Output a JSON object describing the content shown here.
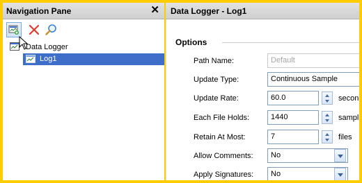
{
  "nav": {
    "title": "Navigation Pane",
    "close_glyph": "✕",
    "toolbar": {
      "add_icon": "add-logger-icon",
      "delete_icon": "delete-x-icon",
      "find_icon": "magnifier-icon"
    },
    "tree": {
      "root_label": "Data Logger",
      "child_label": "Log1"
    }
  },
  "content": {
    "title": "Data Logger - Log1",
    "section_title": "Options",
    "fields": {
      "path_name": {
        "label": "Path Name:",
        "value": "Default"
      },
      "update_type": {
        "label": "Update Type:",
        "value": "Continuous Sample"
      },
      "update_rate": {
        "label": "Update Rate:",
        "value": "60.0",
        "unit": "seconc"
      },
      "file_holds": {
        "label": "Each File Holds:",
        "value": "1440",
        "unit": "sample"
      },
      "retain": {
        "label": "Retain At Most:",
        "value": "7",
        "unit": "files"
      },
      "comments": {
        "label": "Allow Comments:",
        "value": "No"
      },
      "signatures": {
        "label": "Apply Signatures:",
        "value": "No"
      }
    }
  },
  "colors": {
    "highlight_border": "#ffcc00",
    "selection": "#3d6ec9"
  }
}
